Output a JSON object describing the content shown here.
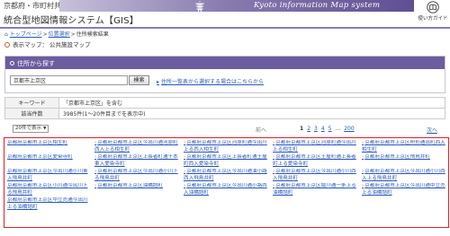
{
  "header": {
    "org": "京都府・市町村共同",
    "title": "統合型地図情報システム【GIS】",
    "banner_text": "Kyoto information Map system",
    "help_label": "使い方ガイド",
    "colors": {
      "banner": "#6c5ca0",
      "accent": "#e0533a",
      "link": "#2a59b8",
      "highlight_border": "#e0202a"
    }
  },
  "breadcrumb": {
    "home": "トップページ",
    "sep": ">",
    "location": "位置選択",
    "current": "住所検索結果"
  },
  "map_select": {
    "label": "表示マップ：",
    "value": "公共施設マップ"
  },
  "search": {
    "heading": "住所から探す",
    "input_value": "京都市上京区",
    "button_label": "検索",
    "list_link": "住所一覧表から選択する場合はこちらから"
  },
  "info": {
    "keyword_label": "キーワード",
    "keyword_value": "「京都市上京区」を含む",
    "count_label": "該当件数",
    "count_value": "3985件(1～20件目までを表示中)"
  },
  "pager": {
    "per_page": "20件で表示",
    "prev": "前へ",
    "pages": [
      "1",
      "2",
      "3",
      "4",
      "5",
      "...",
      "200"
    ],
    "current_page": "1",
    "next": "次へ"
  },
  "results": [
    "京都府京都市上京区相生町",
    "京都府京都市上京区今出川通河原町西入上る相生町",
    "京都府京都市上京区河原町通今出川上る西入相生町",
    "京都府京都市上京区河原町通今出川上る相生町",
    "京都府京都市上京区枡形通出町西入相生町",
    "京都府京都市上京区愛染寺町",
    "京都府京都市上京区上長者町通千本東入愛染寺町",
    "京都府京都市上京区上長者町通土屋町西入愛染寺町",
    "京都府京都市上京区土屋町通上長者町上る愛染寺町",
    "京都府京都市上京区飛鳥井町",
    "京都府京都市上京区今出川通小川東入飛鳥井町",
    "京都府京都市上京区今出川通小川下る飛鳥井町",
    "京都府京都市上京区今出川通油小路西入飛鳥井町",
    "京都府京都市上京区今出川通小川西入飛鳥井町",
    "京都府京都市上京区今出川通小川西入上る飛鳥井町",
    "京都府京都市上京区小川通今出川下る飛鳥井町",
    "京都府京都市上京区油橋詰町",
    "京都府京都市上京区今出川通小路西入油橋詰町",
    "京都府京都市上京区堀川通一条上る油橋詰町",
    "京都府京都市上京区今出川通中立売上る油橋詰町",
    "京都府京都市上京区中立売通今出川上る油橋詰町"
  ]
}
